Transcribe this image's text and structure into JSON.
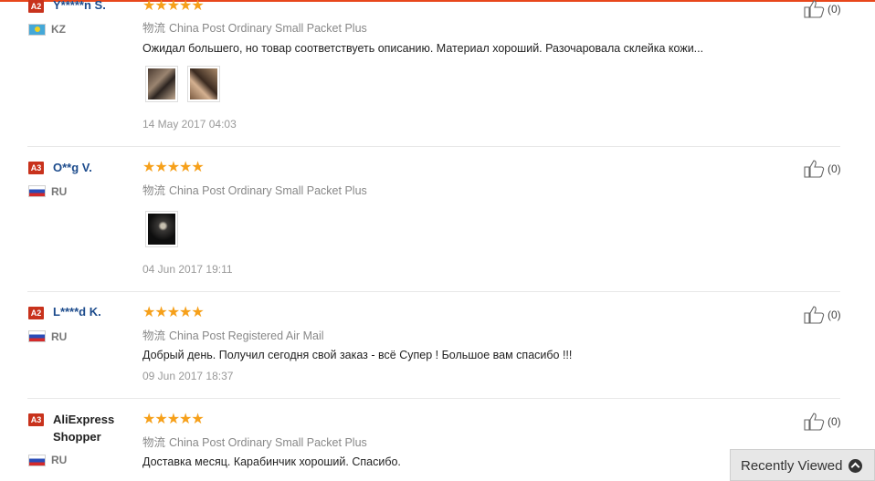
{
  "reviews": [
    {
      "badge": "A2",
      "name": "Y*****n S.",
      "country": "KZ",
      "stars": "★★★★★",
      "logistics_label": "物流",
      "logistics": "China Post Ordinary Small Packet Plus",
      "text": "Ожидал большего, но товар соответствуеть описанию. Материал хороший. Разочаровала склейка кожи...",
      "date": "14 May 2017 04:03",
      "likes": "(0)"
    },
    {
      "badge": "A3",
      "name": "O**g V.",
      "country": "RU",
      "stars": "★★★★★",
      "logistics_label": "物流",
      "logistics": "China Post Ordinary Small Packet Plus",
      "text": "",
      "date": "04 Jun 2017 19:11",
      "likes": "(0)"
    },
    {
      "badge": "A2",
      "name": "L****d K.",
      "country": "RU",
      "stars": "★★★★★",
      "logistics_label": "物流",
      "logistics": "China Post Registered Air Mail",
      "text": "Добрый день. Получил сегодня свой заказ - всё Супер ! Большое вам спасибо !!!",
      "date": "09 Jun 2017 18:37",
      "likes": "(0)"
    },
    {
      "badge": "A3",
      "name": "AliExpress Shopper",
      "country": "RU",
      "stars": "★★★★★",
      "logistics_label": "物流",
      "logistics": "China Post Ordinary Small Packet Plus",
      "text": "Доставка месяц. Карабинчик хороший. Спасибо.",
      "date": "",
      "likes": "(0)"
    }
  ],
  "recently_viewed": {
    "label": "Recently Viewed"
  },
  "icons": {
    "like": "thumbs-up-icon",
    "expand": "chevron-up-icon"
  },
  "colors": {
    "accent": "#e8471b",
    "badge": "#c8321c",
    "name": "#1c4b8c",
    "stars": "#f6a01a"
  }
}
